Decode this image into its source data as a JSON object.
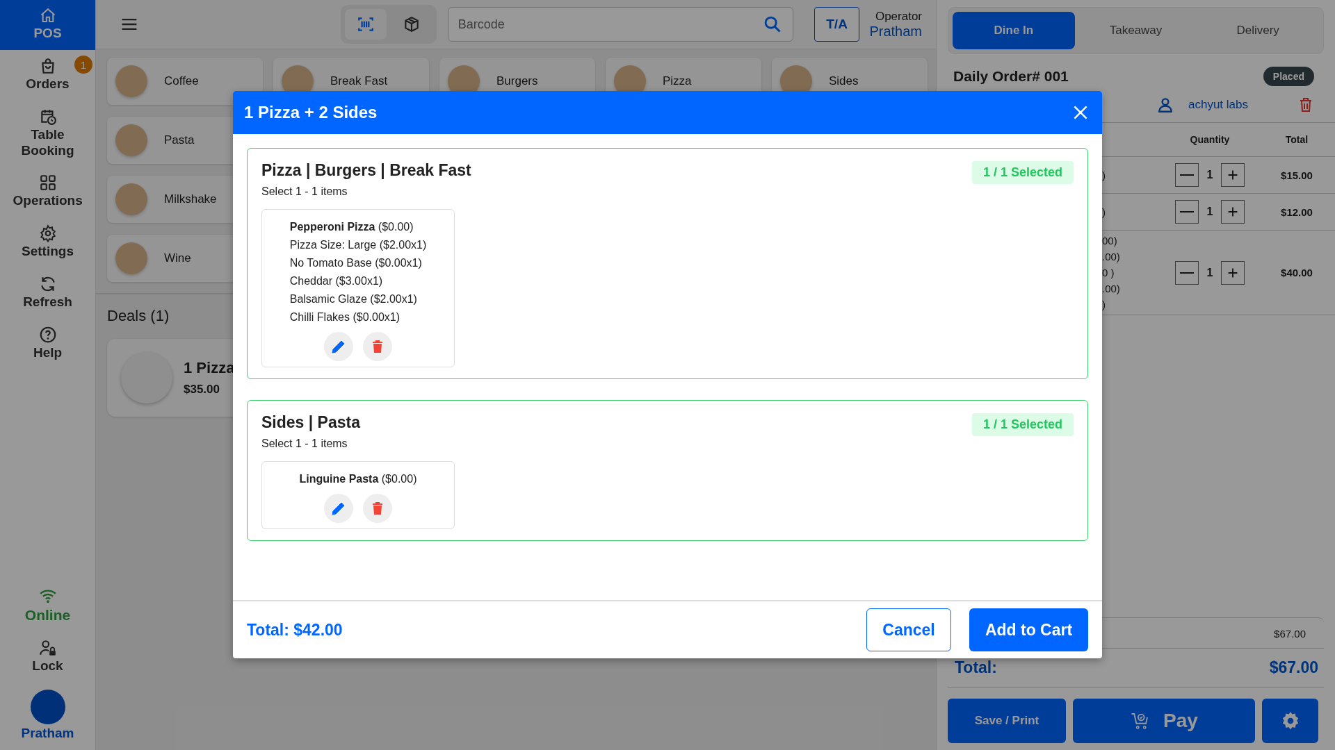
{
  "sidebar": {
    "items": [
      {
        "label": "POS",
        "selected": true
      },
      {
        "label": "Orders",
        "selected": false,
        "badge": "1"
      },
      {
        "label": "Table Booking",
        "selected": false
      },
      {
        "label": "Operations",
        "selected": false
      },
      {
        "label": "Settings",
        "selected": false
      },
      {
        "label": "Refresh",
        "selected": false
      },
      {
        "label": "Help",
        "selected": false
      }
    ],
    "status": {
      "label": "Online",
      "online": true
    },
    "lock": "Lock",
    "user": "Pratham"
  },
  "topbar": {
    "scan_modes": [
      {
        "selected": true
      },
      {
        "selected": false
      }
    ],
    "search": {
      "placeholder": "Barcode"
    },
    "ta_button": "T/A",
    "operator_label": "Operator",
    "operator_name": "Pratham"
  },
  "categories": [
    [
      "Coffee",
      "Break Fast",
      "Burgers",
      "Pizza",
      "Sides"
    ],
    [
      "Pasta"
    ],
    [
      "Milkshake"
    ],
    [
      "Wine"
    ]
  ],
  "deals": {
    "title": "Deals (1)",
    "items": [
      {
        "name": "1 Pizza",
        "price": "$35.00"
      }
    ]
  },
  "order_panel": {
    "tabs": [
      {
        "label": "Dine In",
        "selected": true
      },
      {
        "label": "Takeaway",
        "selected": false
      },
      {
        "label": "Delivery",
        "selected": false
      }
    ],
    "title": "Daily Order# 001",
    "status": "Placed",
    "customer": "achyut labs",
    "columns": [
      "Quantity",
      "Total"
    ],
    "rows": [
      {
        "lines": [
          ")"
        ],
        "quantity": "1",
        "total": "$15.00"
      },
      {
        "lines": [
          ")"
        ],
        "quantity": "1",
        "total": "$12.00"
      },
      {
        "lines": [
          "00)",
          ".00)",
          "0 )",
          ".00)",
          ")"
        ],
        "quantity": "1",
        "total": "$40.00"
      }
    ],
    "subtotal": "$67.00",
    "total_label": "Total:",
    "total": "$67.00",
    "save_button": "Save / Print",
    "pay_button": "Pay"
  },
  "modal": {
    "title": "1 Pizza + 2 Sides",
    "groups": [
      {
        "title": "Pizza | Burgers | Break Fast",
        "subtitle": "Select 1 - 1 items",
        "badge": "1 / 1 Selected",
        "items": [
          {
            "lines": [
              "**Pepperoni Pizza** ($0.00)",
              "Pizza Size: Large ($2.00x1)",
              "No Tomato Base ($0.00x1)",
              "Cheddar ($3.00x1)",
              "Balsamic Glaze ($2.00x1)",
              "Chilli Flakes ($0.00x1)"
            ]
          }
        ]
      },
      {
        "title": "Sides | Pasta",
        "subtitle": "Select 1 - 1 items",
        "badge": "1 / 1 Selected",
        "items": [
          {
            "lines": [
              "**Linguine Pasta** ($0.00)"
            ]
          }
        ]
      }
    ],
    "total": "Total: $42.00",
    "cancel_button": "Cancel",
    "confirm_button": "Add to Cart"
  }
}
